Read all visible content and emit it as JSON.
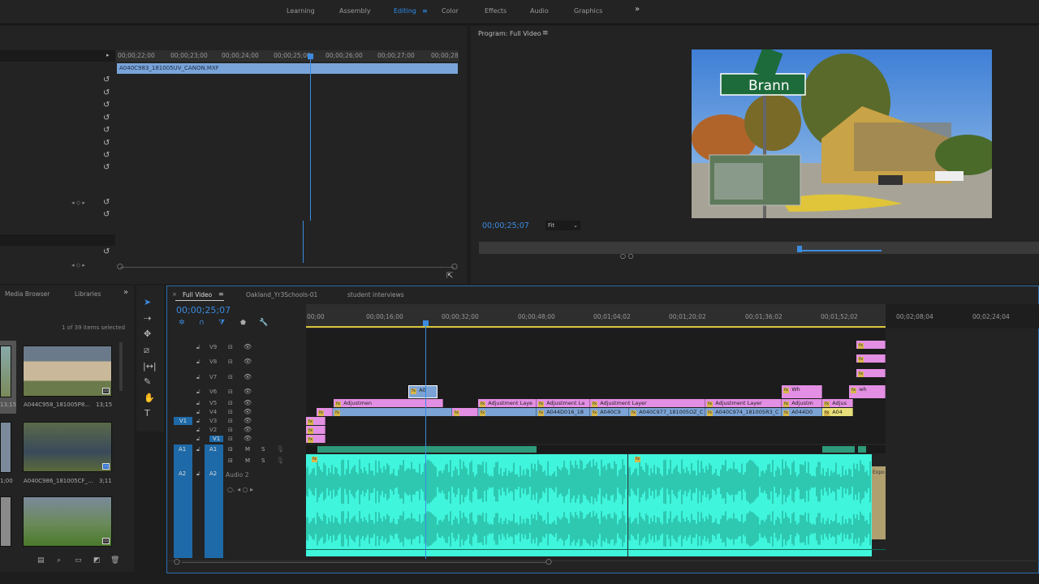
{
  "workspaces": {
    "items": [
      "Learning",
      "Assembly",
      "Editing",
      "Color",
      "Effects",
      "Audio",
      "Graphics"
    ],
    "active": "Editing",
    "more": "»"
  },
  "effect_controls": {
    "ruler_ticks": [
      "00;00;22;00",
      "00;00;23;00",
      "00;00;24;00",
      "00;00;25;00",
      "00;00;26;00",
      "00;00;27;00",
      "00;00;28"
    ],
    "clip_name": "A040C983_181005UV_CANON.MXF"
  },
  "program": {
    "title": "Program: Full Video",
    "menu": "≡",
    "timecode": "00;00;25;07",
    "zoom": "Fit",
    "sign_text": "Brann"
  },
  "project": {
    "tabs": [
      "Media Browser",
      "Libraries"
    ],
    "more": "»",
    "selection": "1 of 39 items selected",
    "items": [
      {
        "name": "A044C958_181005P8...",
        "duration": "13;15"
      },
      {
        "name": "A040C986_181005CF_...",
        "duration": "3;11"
      }
    ],
    "partial_durations": [
      "13;15",
      "1;00"
    ]
  },
  "timeline": {
    "tabs": [
      "Full Video",
      "Oakland_Yr3Schools-01",
      "student interviews"
    ],
    "timecode": "00;00;25;07",
    "ruler_ticks": [
      "00;00",
      "00;00;16;00",
      "00;00;32;00",
      "00;00;48;00",
      "00;01;04;02",
      "00;01;20;02",
      "00;01;36;02",
      "00;01;52;02",
      "00;02;08;04",
      "00;02;24;04"
    ],
    "video_tracks": [
      "V9",
      "V8",
      "V7",
      "V6",
      "V5",
      "V4",
      "V3",
      "V2",
      "V1"
    ],
    "source_v": "V1",
    "audio_tracks": [
      "A1",
      "A2"
    ],
    "audio_track_name": "Audio 2",
    "mute": "M",
    "solo": "S",
    "clips": {
      "v6_sel": "A0",
      "v6_a": "Wh",
      "v6_b": "wh",
      "v5": [
        "Adjustmen",
        "Adjustment Laye",
        "Adjustment La",
        "Adjustment Layer",
        "Adjustment Layer",
        "Adjustm",
        "Adjus"
      ],
      "v4": [
        "A044D016_18",
        "A040C9",
        "A040C977_181005OZ_C",
        "A040C974_181005R3_C",
        "A044D0",
        "A04"
      ],
      "fx": "fx",
      "audio_end": "Expo"
    }
  }
}
